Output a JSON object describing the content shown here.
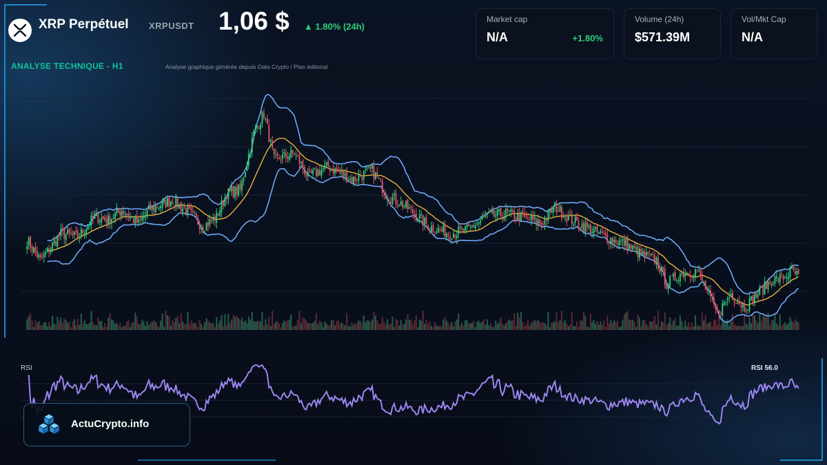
{
  "header": {
    "title": "XRP Perpétuel",
    "ticker": "XRPUSDT",
    "price": "1,06 $",
    "change": "▲ 1.80% (24h)"
  },
  "stats": [
    {
      "label": "Market cap",
      "value": "N/A",
      "delta": "+1.80%"
    },
    {
      "label": "Volume (24h)",
      "value": "$571.39M",
      "delta": ""
    },
    {
      "label": "Vol/Mkt Cap",
      "value": "N/A",
      "delta": ""
    }
  ],
  "section": {
    "title": "ANALYSE TECHNIQUE - H1",
    "subtitle": "Analyse graphique générée depuis Data Crypto / Plan éditorial"
  },
  "rsi": {
    "label": "RSI",
    "value_text": "RSI 56.0"
  },
  "brand": {
    "name": "ActuCrypto.info"
  },
  "colors": {
    "accent_teal": "#14c39a",
    "up": "#2fcf7a",
    "down": "#e25562",
    "bollinger": "#6fa8f5",
    "moving_average": "#f0b33c",
    "rsi_line": "#9d86f0",
    "frame": "#1e88c8"
  },
  "icons": {
    "logo": "xrp-logo-icon",
    "brand": "stacked-cubes-icon"
  },
  "chart_data": {
    "type": "candlestick",
    "grid": true,
    "price_range": [
      0.82,
      1.52
    ],
    "price_anchors": [
      [
        0,
        1.08
      ],
      [
        8,
        1.02
      ],
      [
        14,
        1.06
      ],
      [
        20,
        1.1
      ],
      [
        30,
        1.09
      ],
      [
        40,
        1.15
      ],
      [
        48,
        1.14
      ],
      [
        56,
        1.17
      ],
      [
        66,
        1.13
      ],
      [
        72,
        1.17
      ],
      [
        86,
        1.2
      ],
      [
        96,
        1.16
      ],
      [
        104,
        1.12
      ],
      [
        112,
        1.15
      ],
      [
        118,
        1.22
      ],
      [
        126,
        1.23
      ],
      [
        134,
        1.4
      ],
      [
        140,
        1.46
      ],
      [
        146,
        1.32
      ],
      [
        158,
        1.34
      ],
      [
        166,
        1.27
      ],
      [
        178,
        1.3
      ],
      [
        192,
        1.26
      ],
      [
        204,
        1.29
      ],
      [
        212,
        1.22
      ],
      [
        224,
        1.18
      ],
      [
        238,
        1.12
      ],
      [
        250,
        1.1
      ],
      [
        260,
        1.11
      ],
      [
        272,
        1.15
      ],
      [
        284,
        1.16
      ],
      [
        298,
        1.14
      ],
      [
        304,
        1.13
      ],
      [
        312,
        1.18
      ],
      [
        322,
        1.14
      ],
      [
        334,
        1.11
      ],
      [
        346,
        1.08
      ],
      [
        354,
        1.07
      ],
      [
        362,
        1.04
      ],
      [
        372,
        1.02
      ],
      [
        378,
        0.95
      ],
      [
        386,
        0.98
      ],
      [
        396,
        0.99
      ],
      [
        408,
        0.86
      ],
      [
        416,
        0.92
      ],
      [
        424,
        0.88
      ],
      [
        432,
        0.92
      ],
      [
        440,
        0.96
      ],
      [
        448,
        0.97
      ],
      [
        452,
        0.99
      ],
      [
        456,
        0.97
      ]
    ],
    "volume": true,
    "indicators": [
      "Bollinger Bands (20, 2)",
      "Moving Average (20)",
      "Volume"
    ],
    "rsi": {
      "current": 56.0
    }
  }
}
